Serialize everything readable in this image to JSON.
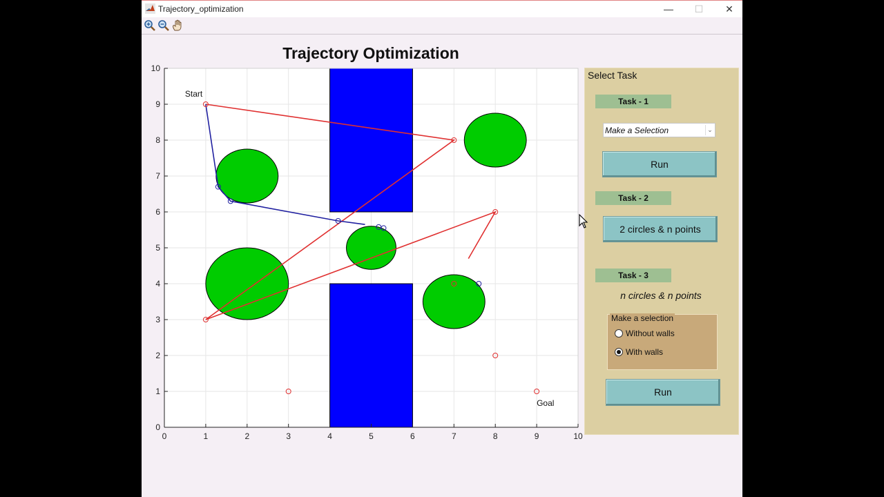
{
  "window": {
    "title": "Trajectory_optimization",
    "controls": {
      "minimize": "—",
      "maximize": "☐",
      "close": "✕"
    }
  },
  "toolbar": {
    "tools": [
      "zoom-in-icon",
      "zoom-out-icon",
      "pan-hand-icon"
    ]
  },
  "plot": {
    "title": "Trajectory Optimization",
    "start_label": "Start",
    "goal_label": "Goal"
  },
  "chart_data": {
    "type": "scatter",
    "title": "Trajectory Optimization",
    "xlim": [
      0,
      10
    ],
    "ylim": [
      0,
      10
    ],
    "x_ticks": [
      "0",
      "1",
      "2",
      "3",
      "4",
      "5",
      "6",
      "7",
      "8",
      "9",
      "10"
    ],
    "y_ticks": [
      "0",
      "1",
      "2",
      "3",
      "4",
      "5",
      "6",
      "7",
      "8",
      "9",
      "10"
    ],
    "grid": true,
    "walls": [
      {
        "x": [
          4,
          6
        ],
        "y": [
          6,
          10
        ],
        "color": "#0000ff"
      },
      {
        "x": [
          4,
          6
        ],
        "y": [
          0,
          4
        ],
        "color": "#0000ff"
      }
    ],
    "circles": [
      {
        "cx": 2.0,
        "cy": 7.0,
        "rx": 0.75,
        "ry": 0.75
      },
      {
        "cx": 8.0,
        "cy": 8.0,
        "rx": 0.75,
        "ry": 0.75
      },
      {
        "cx": 2.0,
        "cy": 4.0,
        "rx": 1.0,
        "ry": 1.0
      },
      {
        "cx": 5.0,
        "cy": 5.0,
        "rx": 0.6,
        "ry": 0.6
      },
      {
        "cx": 7.0,
        "cy": 3.5,
        "rx": 0.75,
        "ry": 0.75
      }
    ],
    "circle_color": "#00cc00",
    "red_path": [
      [
        1,
        9
      ],
      [
        7,
        8
      ],
      [
        1,
        3
      ],
      [
        8,
        6
      ],
      [
        7.35,
        4.7
      ]
    ],
    "red_points": [
      [
        1,
        9
      ],
      [
        7,
        8
      ],
      [
        1,
        3
      ],
      [
        8,
        6
      ],
      [
        3,
        1
      ],
      [
        7,
        4
      ],
      [
        8,
        2
      ],
      [
        9,
        1
      ]
    ],
    "blue_path": [
      [
        1,
        9
      ],
      [
        1.3,
        6.7
      ],
      [
        1.6,
        6.3
      ],
      [
        4.2,
        5.75
      ],
      [
        4.85,
        5.65
      ]
    ],
    "blue_points": [
      [
        1.3,
        6.7
      ],
      [
        1.6,
        6.3
      ],
      [
        4.2,
        5.75
      ],
      [
        5.18,
        5.58
      ],
      [
        5.3,
        5.55
      ],
      [
        7.6,
        4.0
      ]
    ],
    "red_color": "#e03030",
    "blue_color": "#2020a0",
    "start": [
      1,
      9
    ],
    "goal": [
      9,
      1
    ]
  },
  "panel": {
    "title": "Select Task",
    "task1": {
      "badge": "Task - 1",
      "dropdown_value": "Make a Selection",
      "run_label": "Run"
    },
    "task2": {
      "badge": "Task - 2",
      "button_label": "2 circles & n points"
    },
    "task3": {
      "badge": "Task - 3",
      "description": "n circles & n points",
      "selection_title": "Make a selection",
      "options": [
        {
          "label": "Without walls",
          "selected": false
        },
        {
          "label": "With walls",
          "selected": true
        }
      ],
      "run_label": "Run"
    }
  }
}
